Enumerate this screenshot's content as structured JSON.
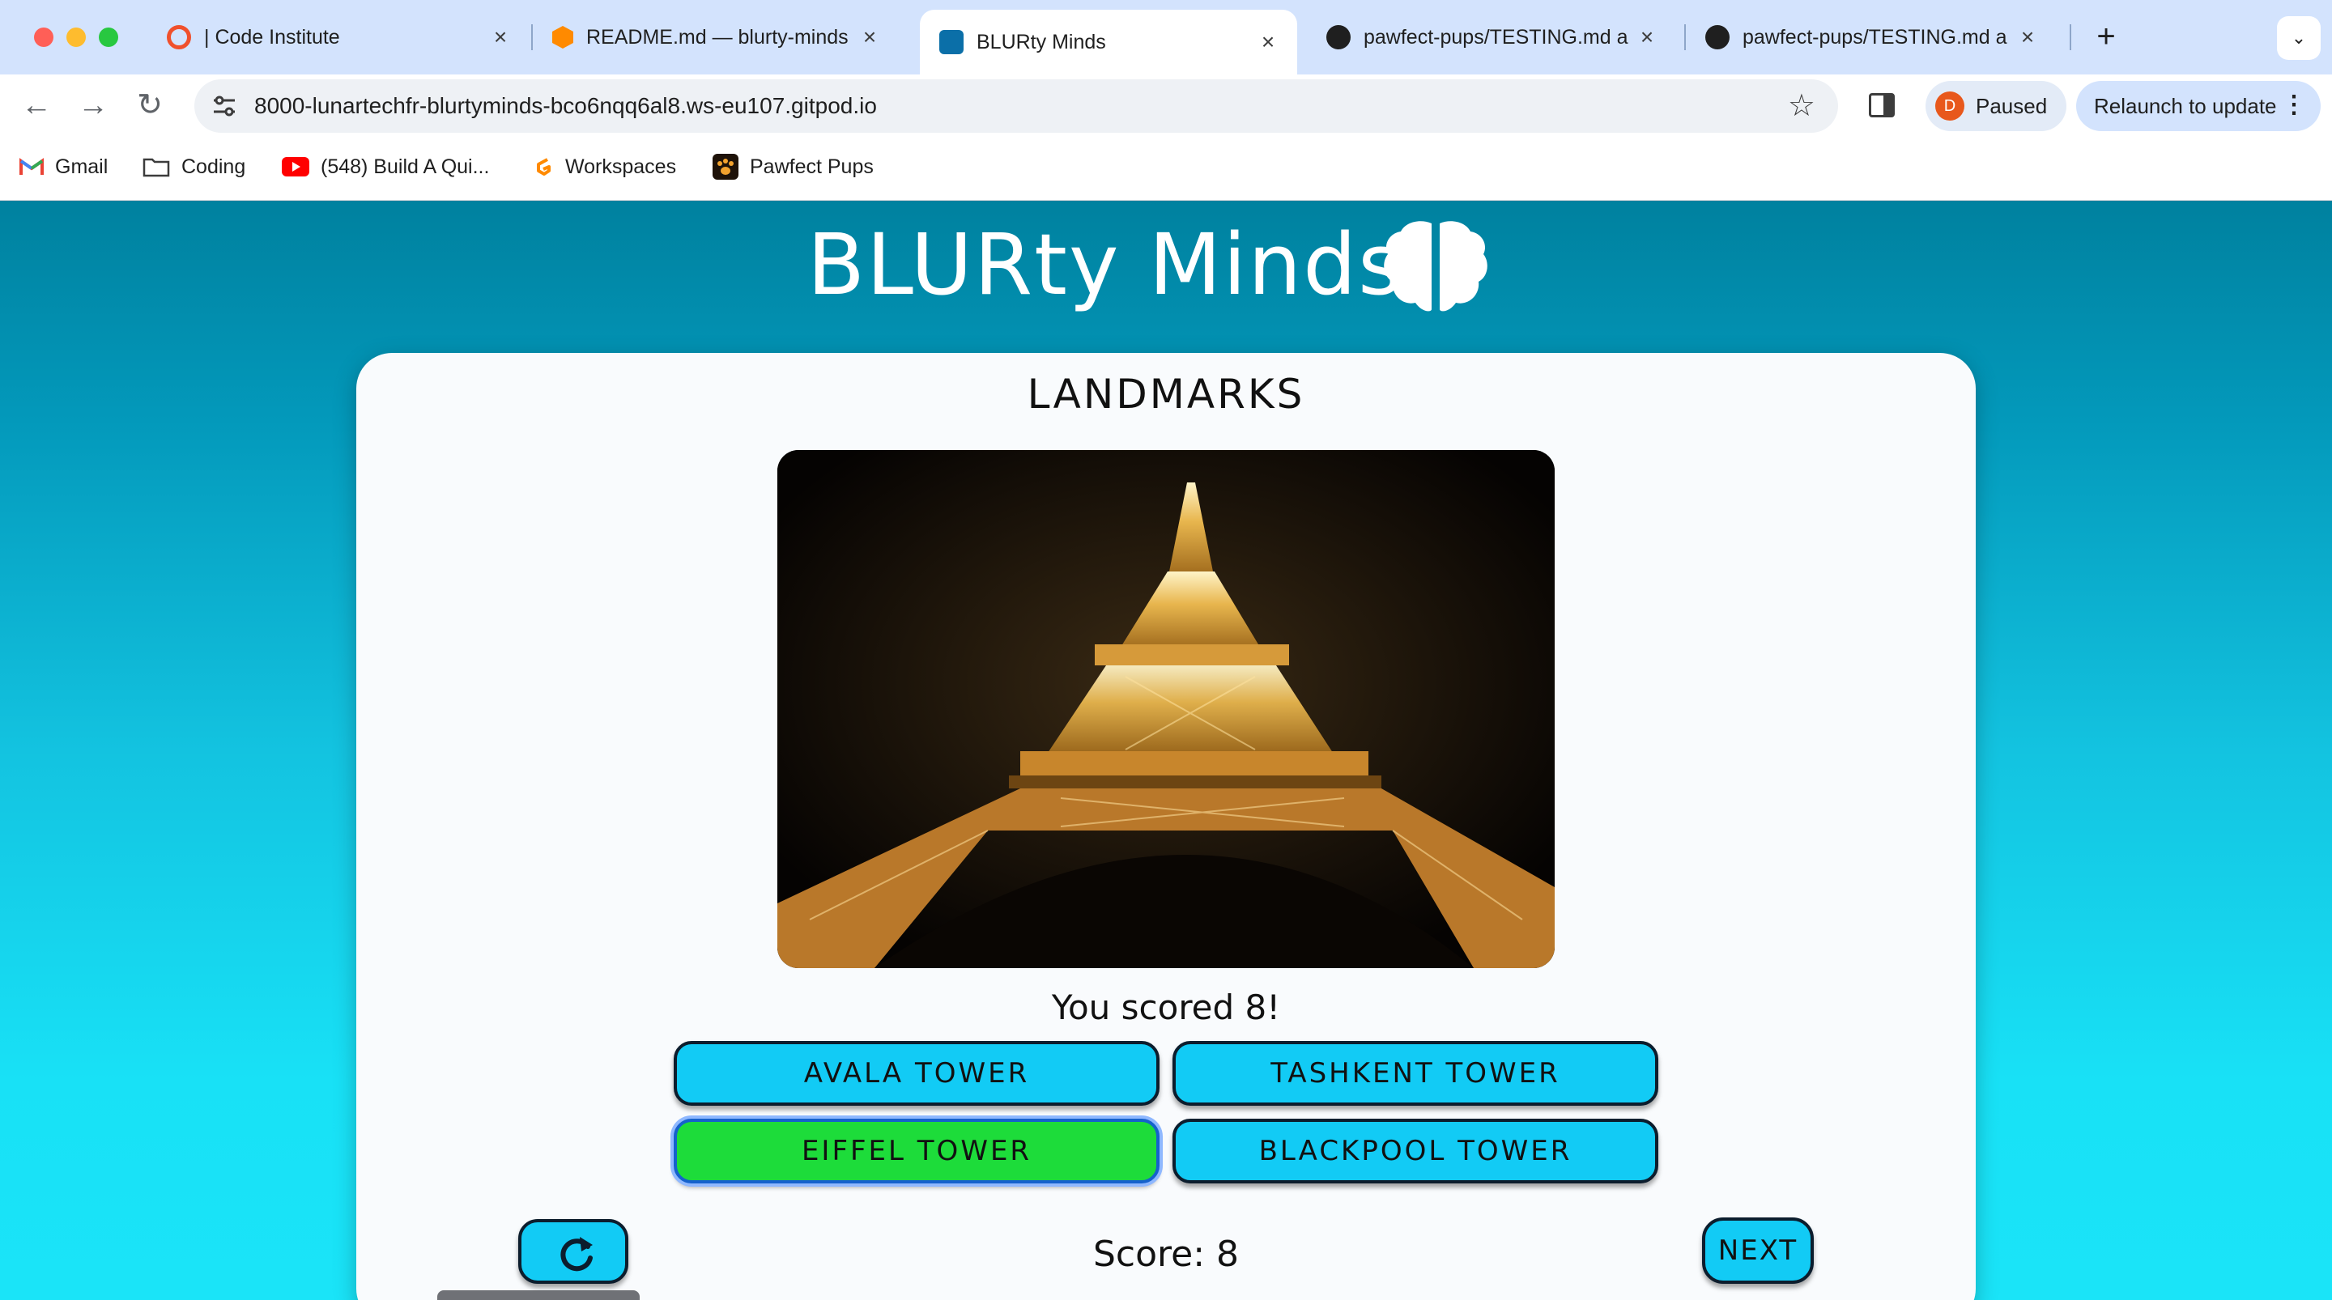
{
  "browser": {
    "tabs": [
      {
        "title": "| Code Institute",
        "icon": "code-institute-icon",
        "active": false
      },
      {
        "title": "README.md — blurty-minds",
        "icon": "gitpod-icon",
        "active": false
      },
      {
        "title": "BLURty Minds",
        "icon": "brain-icon",
        "active": true
      },
      {
        "title": "pawfect-pups/TESTING.md a",
        "icon": "github-icon",
        "active": false
      },
      {
        "title": "pawfect-pups/TESTING.md a",
        "icon": "github-icon",
        "active": false
      }
    ],
    "close_glyph": "×",
    "new_tab_glyph": "+",
    "url": "8000-lunartechfr-blurtyminds-bco6nqq6al8.ws-eu107.gitpod.io",
    "profile_initial": "D",
    "profile_status": "Paused",
    "relaunch_label": "Relaunch to update",
    "bookmarks": [
      {
        "label": "Gmail",
        "icon": "gmail-icon"
      },
      {
        "label": "Coding",
        "icon": "folder-icon"
      },
      {
        "label": "(548) Build A Qui...",
        "icon": "youtube-icon"
      },
      {
        "label": "Workspaces",
        "icon": "gitpod-icon"
      },
      {
        "label": "Pawfect Pups",
        "icon": "paw-icon"
      }
    ]
  },
  "app": {
    "title": "BLURty Minds",
    "category": "LANDMARKS",
    "image_subject": "Eiffel Tower at night",
    "result_text": "You scored 8!",
    "answers": [
      {
        "label": "AVALA TOWER",
        "state": "default"
      },
      {
        "label": "TASHKENT TOWER",
        "state": "default"
      },
      {
        "label": "EIFFEL TOWER",
        "state": "correct"
      },
      {
        "label": "BLACKPOOL TOWER",
        "state": "default"
      }
    ],
    "score_label": "Score: 8",
    "next_label": "NEXT",
    "colors": {
      "answer_default": "#12cbf5",
      "answer_correct": "#1ddc3a",
      "background_top": "#00819f",
      "background_bottom": "#1ae4f8"
    }
  }
}
